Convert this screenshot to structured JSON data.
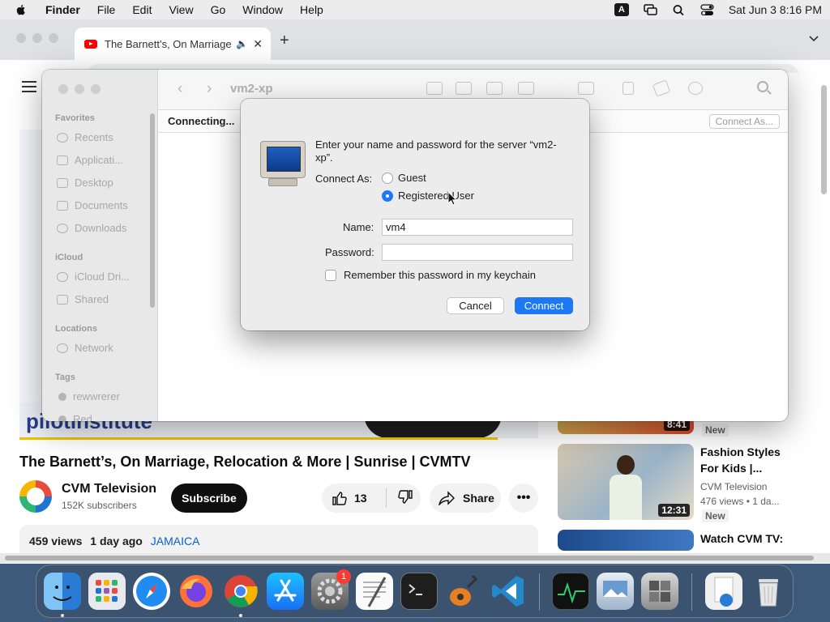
{
  "menubar": {
    "app_name": "Finder",
    "items": [
      "File",
      "Edit",
      "View",
      "Go",
      "Window",
      "Help"
    ],
    "input_badge": "A",
    "clock": "Sat Jun 3  8:16 PM"
  },
  "browser": {
    "tab_title": "The Barnett’s, On Marriage",
    "url": "youtube.com/watch?v=rCfQLw77H9o",
    "video_logo_text": "pilotinstitute",
    "video_title": "The Barnett’s, On Marriage, Relocation & More | Sunrise | CVMTV",
    "channel_name": "CVM Television",
    "subscribers": "152K subscribers",
    "subscribe_label": "Subscribe",
    "like_count": "13",
    "share_label": "Share",
    "views": "459 views",
    "posted": "1 day ago",
    "hashtag": "JAMAICA",
    "sidebar_videos": [
      {
        "duration": "8:41",
        "badge": "New"
      },
      {
        "title": "Fashion Styles For Kids |...",
        "channel": "CVM Television",
        "meta": "476 views  •  1 da...",
        "duration": "12:31",
        "badge": "New"
      },
      {
        "title": "Watch CVM TV:"
      }
    ]
  },
  "finder": {
    "title": "vm2-xp",
    "status": "Connecting...",
    "connect_as_label": "Connect As...",
    "sections": {
      "favorites": "Favorites",
      "icloud": "iCloud",
      "locations": "Locations",
      "tags": "Tags"
    },
    "favorites": [
      "Recents",
      "Applicati...",
      "Desktop",
      "Documents",
      "Downloads"
    ],
    "icloud": [
      "iCloud Dri...",
      "Shared"
    ],
    "locations": [
      "Network"
    ],
    "tags": [
      "rewwrerer",
      "Red"
    ]
  },
  "dialog": {
    "message": "Enter your name and password for the server “vm2-xp”.",
    "connect_as_label": "Connect As:",
    "guest_label": "Guest",
    "registered_label": "Registered User",
    "selected": "Registered User",
    "name_label": "Name:",
    "name_value": "vm4",
    "password_label": "Password:",
    "password_value": "",
    "remember_label": "Remember this password in my keychain",
    "remember_checked": false,
    "cancel_label": "Cancel",
    "connect_label": "Connect"
  },
  "dock": {
    "apps": [
      "finder",
      "launchpad",
      "safari",
      "firefox",
      "chrome",
      "app-store",
      "system-preferences",
      "textedit",
      "terminal",
      "garageband",
      "vscode",
      "activity-monitor",
      "preview",
      "boot-camp",
      "downloads-stack",
      "trash"
    ],
    "settings_badge": "1"
  }
}
